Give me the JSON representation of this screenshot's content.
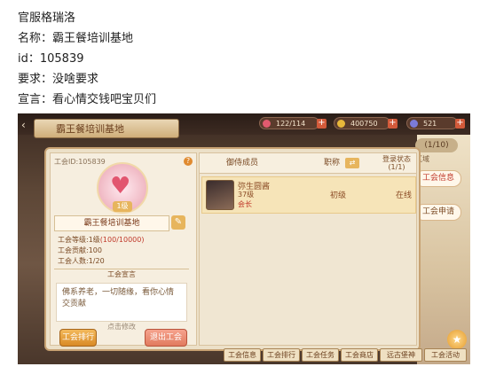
{
  "post": {
    "line1": "官服格瑞洛",
    "line2": "名称：霸王餐培训基地",
    "line3": "id：105839",
    "line4": "要求：没啥要求",
    "line5": "宣言：看心情交钱吧宝贝们"
  },
  "game": {
    "title": "霸王餐培训基地",
    "resources": [
      {
        "label": "122/114",
        "icon": "heart-icon",
        "color": "#e25b6f"
      },
      {
        "label": "400750",
        "icon": "coin-icon",
        "color": "#e8b73a"
      },
      {
        "label": "521",
        "icon": "gem-icon",
        "color": "#7b7bd8"
      }
    ],
    "page_indicator": "(1/10)",
    "area_hint": "区域",
    "side_tabs": {
      "info": "工会信息",
      "apply": "工会申请"
    },
    "left_panel": {
      "guild_id": "工会ID:105839",
      "help": "?",
      "emblem_level": "1级",
      "guild_name": "霸王餐培训基地",
      "level_label": "工会等级:1级",
      "level_points": "(100/10000)",
      "contribution": "工会贡献:100",
      "members": "工会人数:1/20",
      "motto_header": "工会宣言",
      "motto": "佛系养老，一切随缘，看你心情交贡献",
      "click_edit": "点击修改",
      "rank_button": "工会排行",
      "quit_button": "退出工会"
    },
    "right_panel": {
      "col_member": "御侍成员",
      "col_title": "职称",
      "sort_icon": "⇄",
      "col_login": "登录状态",
      "col_login_count": "(1/1)",
      "member": {
        "name": "弥生圆酱",
        "level": "37级",
        "role": "会长",
        "title": "初级",
        "status": "在线"
      }
    },
    "bottom_tabs": [
      "工会信息",
      "工会排行",
      "工会任务",
      "工会商店",
      "远古堡神",
      "工会活动"
    ]
  }
}
